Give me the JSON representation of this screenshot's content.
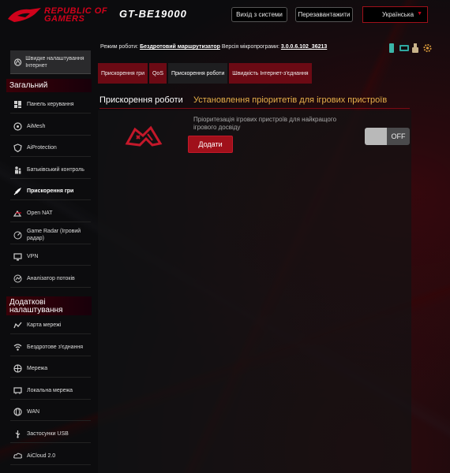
{
  "header": {
    "brand_line1": "REPUBLIC OF",
    "brand_line2": "GAMERS",
    "model": "GT-BE19000",
    "logout_label": "Вихід з системи",
    "reboot_label": "Перезавантажити",
    "language": "Українська"
  },
  "info": {
    "mode_label": "Режим роботи:",
    "mode_value": "Бездротовий маршрутизатор",
    "firmware_label": "Версія мікропрограми:",
    "firmware_value": "3.0.0.6.102_36213"
  },
  "sidebar": {
    "quick_setup": "Швидке налаштування Інтернет",
    "general_title": "Загальний",
    "general_items": [
      {
        "label": "Панель керування",
        "icon": "dashboard-icon"
      },
      {
        "label": "AiMesh",
        "icon": "aimesh-icon"
      },
      {
        "label": "AiProtection",
        "icon": "shield-icon"
      },
      {
        "label": "Батьківський контроль",
        "icon": "parental-icon"
      },
      {
        "label": "Прискорення гри",
        "icon": "rocket-icon"
      },
      {
        "label": "Open NAT",
        "icon": "open-nat-icon"
      },
      {
        "label": "Game Radar (Ігровий радар)",
        "icon": "radar-icon"
      },
      {
        "label": "VPN",
        "icon": "vpn-icon"
      },
      {
        "label": "Аналізатор потоків",
        "icon": "analyzer-icon"
      }
    ],
    "advanced_title": "Додаткові налаштування",
    "advanced_items": [
      {
        "label": "Карта мережі",
        "icon": "network-map-icon"
      },
      {
        "label": "Бездротове з'єднання",
        "icon": "wireless-icon"
      },
      {
        "label": "Мережа",
        "icon": "network-icon"
      },
      {
        "label": "Локальна мережа",
        "icon": "lan-icon"
      },
      {
        "label": "WAN",
        "icon": "wan-icon"
      },
      {
        "label": "Застосунки USB",
        "icon": "usb-icon"
      },
      {
        "label": "AiCloud 2.0",
        "icon": "cloud-icon"
      }
    ]
  },
  "tabs": [
    {
      "label": "Прискорення гри"
    },
    {
      "label": "QoS"
    },
    {
      "label": "Прискорення роботи"
    },
    {
      "label": "Швидкість Інтернет-з'єднання"
    }
  ],
  "content": {
    "title": "Прискорення роботи",
    "subtitle": "Установлення пріоритетів для ігрових пристроїв",
    "description": "Пріоритезація ігрових пристроїв для найкращого ігрового досвіду",
    "add_label": "Додати",
    "toggle_state": "OFF"
  },
  "colors": {
    "accent": "#d0021b",
    "tab_bg": "#6b0a14",
    "subtitle": "#e8b14a"
  }
}
